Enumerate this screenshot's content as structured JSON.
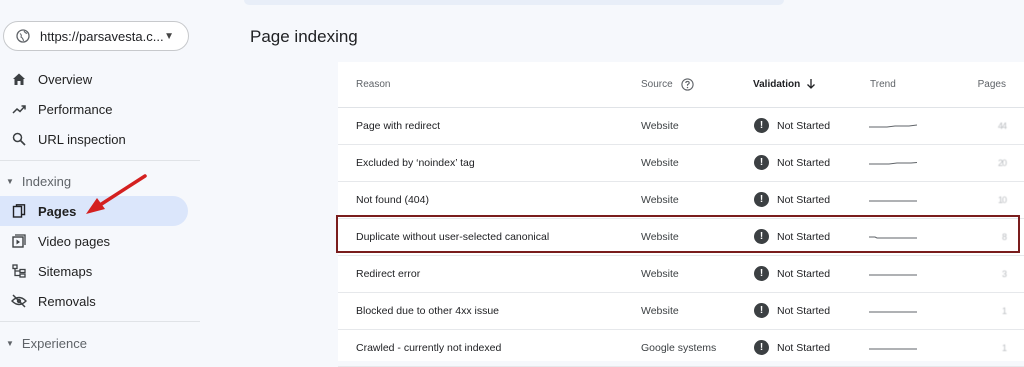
{
  "sidebar": {
    "property_label": "https://parsavesta.c...",
    "nav": [
      {
        "label": "Overview",
        "icon": "home-icon"
      },
      {
        "label": "Performance",
        "icon": "trending-up-icon"
      },
      {
        "label": "URL inspection",
        "icon": "search-icon"
      }
    ],
    "indexing_section": "Indexing",
    "indexing_items": [
      {
        "label": "Pages",
        "icon": "pages-icon",
        "active": true
      },
      {
        "label": "Video pages",
        "icon": "video-pages-icon"
      },
      {
        "label": "Sitemaps",
        "icon": "sitemap-icon"
      },
      {
        "label": "Removals",
        "icon": "removals-icon"
      }
    ],
    "experience_section": "Experience"
  },
  "main": {
    "title": "Page indexing",
    "table": {
      "headers": {
        "reason": "Reason",
        "source": "Source",
        "validation": "Validation",
        "trend": "Trend",
        "pages": "Pages"
      },
      "rows": [
        {
          "reason": "Page with redirect",
          "source": "Website",
          "validation": "Not Started",
          "pages": "44"
        },
        {
          "reason": "Excluded by ‘noindex’ tag",
          "source": "Website",
          "validation": "Not Started",
          "pages": "20"
        },
        {
          "reason": "Not found (404)",
          "source": "Website",
          "validation": "Not Started",
          "pages": "10"
        },
        {
          "reason": "Duplicate without user-selected canonical",
          "source": "Website",
          "validation": "Not Started",
          "pages": "8"
        },
        {
          "reason": "Redirect error",
          "source": "Website",
          "validation": "Not Started",
          "pages": "3"
        },
        {
          "reason": "Blocked due to other 4xx issue",
          "source": "Website",
          "validation": "Not Started",
          "pages": "1"
        },
        {
          "reason": "Crawled - currently not indexed",
          "source": "Google systems",
          "validation": "Not Started",
          "pages": "1"
        }
      ]
    }
  },
  "colors": {
    "active_nav_bg": "#dbe6fb",
    "highlight_border": "#7a1d1d",
    "annotation_arrow": "#d42020"
  }
}
